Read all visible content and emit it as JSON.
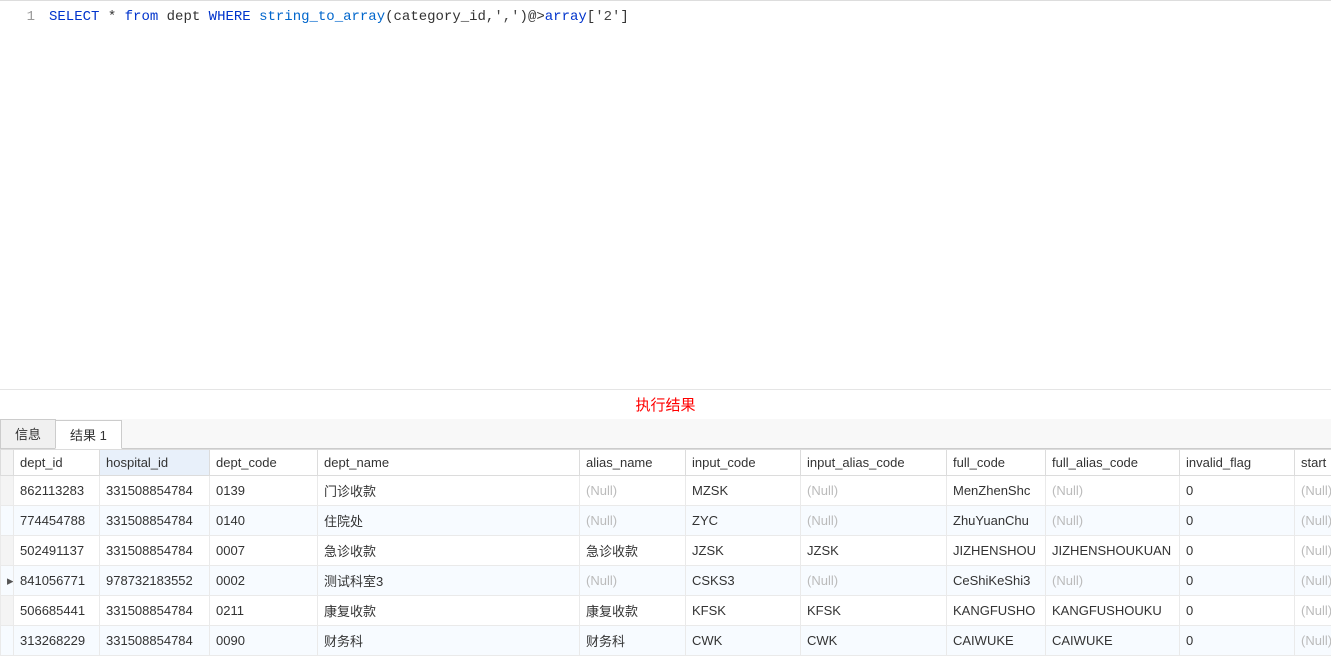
{
  "editor": {
    "line_no": "1",
    "sql": {
      "k_select": "SELECT",
      "star": " * ",
      "k_from": "from",
      "table": " dept ",
      "k_where": "WHERE",
      "fn_str2arr": " string_to_array",
      "args1": "(category_id,",
      "str_comma": "','",
      "args2": ")@>",
      "k_array": "array",
      "br_open": "[",
      "str_two": "'2'",
      "br_close": "]"
    }
  },
  "result_label": "执行结果",
  "tabs": {
    "info": "信息",
    "result1": "结果 1"
  },
  "columns": [
    "dept_id",
    "hospital_id",
    "dept_code",
    "dept_name",
    "alias_name",
    "input_code",
    "input_alias_code",
    "full_code",
    "full_alias_code",
    "invalid_flag",
    "start"
  ],
  "null_text": "(Null)",
  "rows": [
    {
      "mark": "",
      "dept_id": "862113283",
      "hospital_id": "331508854784",
      "dept_code": "0139",
      "dept_name": "门诊收款",
      "alias_name": null,
      "input_code": "MZSK",
      "input_alias_code": null,
      "full_code": "MenZhenShc",
      "full_alias_code": null,
      "invalid_flag": "0",
      "start": null
    },
    {
      "mark": "",
      "dept_id": "774454788",
      "hospital_id": "331508854784",
      "dept_code": "0140",
      "dept_name": "住院处",
      "alias_name": null,
      "input_code": "ZYC",
      "input_alias_code": null,
      "full_code": "ZhuYuanChu",
      "full_alias_code": null,
      "invalid_flag": "0",
      "start": null
    },
    {
      "mark": "",
      "dept_id": "502491137",
      "hospital_id": "331508854784",
      "dept_code": "0007",
      "dept_name": "急诊收款",
      "alias_name": "急诊收款",
      "input_code": "JZSK",
      "input_alias_code": "JZSK",
      "full_code": "JIZHENSHOU",
      "full_alias_code": "JIZHENSHOUKUAN",
      "invalid_flag": "0",
      "start": null
    },
    {
      "mark": "▸",
      "dept_id": "841056771",
      "hospital_id": "978732183552",
      "dept_code": "0002",
      "dept_name": "测试科室3",
      "alias_name": null,
      "input_code": "CSKS3",
      "input_alias_code": null,
      "full_code": "CeShiKeShi3",
      "full_alias_code": null,
      "invalid_flag": "0",
      "start": null
    },
    {
      "mark": "",
      "dept_id": "506685441",
      "hospital_id": "331508854784",
      "dept_code": "0211",
      "dept_name": "康复收款",
      "alias_name": "康复收款",
      "input_code": "KFSK",
      "input_alias_code": "KFSK",
      "full_code": "KANGFUSHO",
      "full_alias_code": "KANGFUSHOUKU",
      "invalid_flag": "0",
      "start": null
    },
    {
      "mark": "",
      "dept_id": "313268229",
      "hospital_id": "331508854784",
      "dept_code": "0090",
      "dept_name": "财务科",
      "alias_name": "财务科",
      "input_code": "CWK",
      "input_alias_code": "CWK",
      "full_code": "CAIWUKE",
      "full_alias_code": "CAIWUKE",
      "invalid_flag": "0",
      "start": null
    }
  ]
}
